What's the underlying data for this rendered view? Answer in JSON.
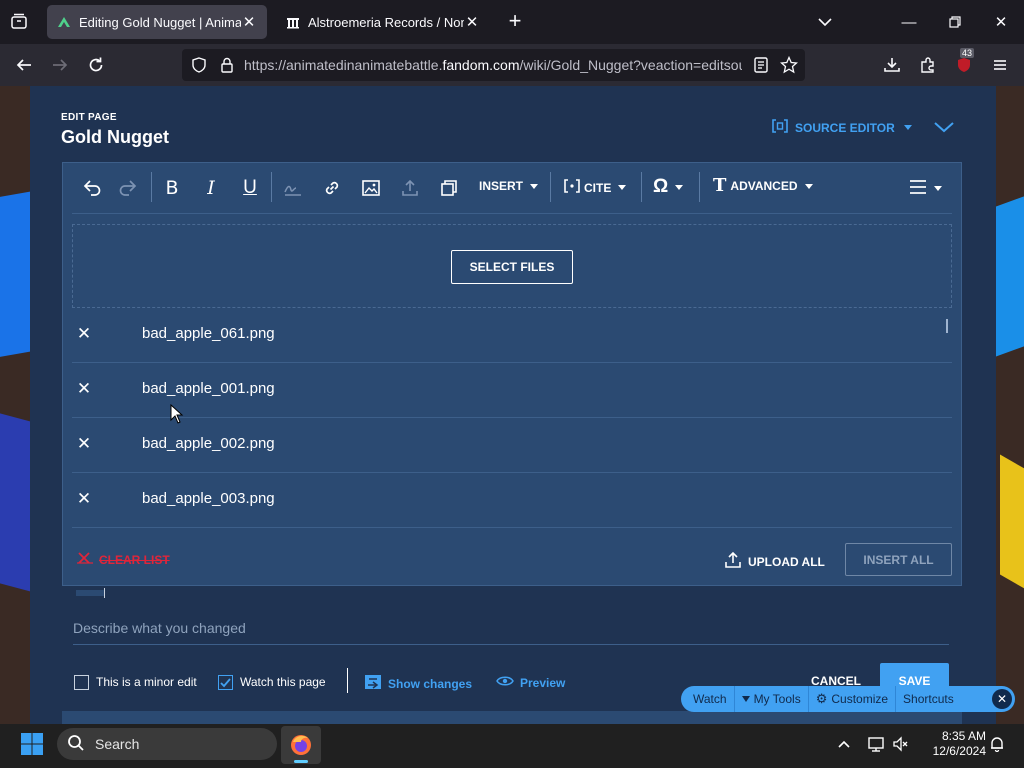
{
  "browser": {
    "tabs": [
      {
        "label": "Editing Gold Nugget | Animatec",
        "active": true
      },
      {
        "label": "Alstroemeria Records / Nomico",
        "active": false
      }
    ],
    "url": {
      "prefix": "https://animatedinanimatebattle.",
      "domain": "fandom.com",
      "path": "/wiki/Gold_Nugget?veaction=editsou"
    },
    "extensions_badge": "43"
  },
  "editor": {
    "kicker": "EDIT PAGE",
    "page_title": "Gold Nugget",
    "source_editor_label": "SOURCE EDITOR",
    "toolbar": {
      "insert_label": "INSERT",
      "cite_label": "CITE",
      "advanced_label": "ADVANCED"
    },
    "upload": {
      "select_files_label": "SELECT FILES",
      "files": [
        "bad_apple_061.png",
        "bad_apple_001.png",
        "bad_apple_002.png",
        "bad_apple_003.png"
      ],
      "clear_list_label": "CLEAR LIST",
      "upload_all_label": "UPLOAD ALL",
      "insert_all_label": "INSERT ALL"
    },
    "summary_placeholder": "Describe what you changed",
    "minor_edit_label": "This is a minor edit",
    "minor_edit_checked": false,
    "watch_page_label": "Watch this page",
    "watch_page_checked": true,
    "show_changes_label": "Show changes",
    "preview_label": "Preview",
    "cancel_label": "CANCEL",
    "save_label": "SAVE"
  },
  "floating_toolbar": {
    "watch": "Watch",
    "my_tools": "My Tools",
    "customize": "Customize",
    "shortcuts": "Shortcuts"
  },
  "taskbar": {
    "search_label": "Search",
    "time": "8:35 AM",
    "date": "12/6/2024"
  },
  "colors": {
    "accent": "#41a1f2",
    "panel": "#1f3352",
    "editor_surface": "#2b4a72",
    "danger": "#e0253a"
  }
}
